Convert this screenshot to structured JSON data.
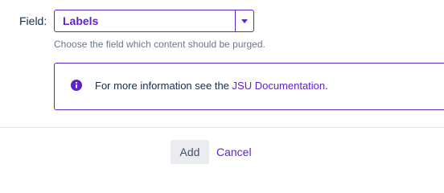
{
  "form": {
    "field_label": "Field:",
    "field_value": "Labels",
    "help_text": "Choose the field which content should be purged."
  },
  "info": {
    "text_before": "For more information see the ",
    "link_text": "JSU Documentation",
    "text_after": ".",
    "icon": "info-icon"
  },
  "actions": {
    "add_label": "Add",
    "cancel_label": "Cancel"
  },
  "colors": {
    "accent": "#5f24c7",
    "text": "#172b4d",
    "muted": "#6b778c",
    "button_bg": "#ebecf0",
    "divider": "#dfe1e6"
  }
}
